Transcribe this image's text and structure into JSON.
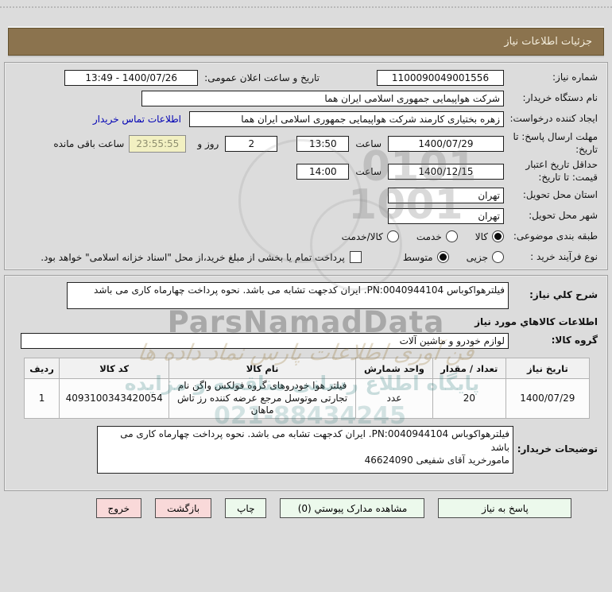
{
  "header": {
    "title": "جزئیات اطلاعات نیاز"
  },
  "form": {
    "need_number": {
      "label": "شماره نیاز:",
      "value": "1100090049001556"
    },
    "announce": {
      "label": "تاریخ و ساعت اعلان عمومی:",
      "value": "13:49 - 1400/07/26"
    },
    "buyer": {
      "label": "نام دستگاه خریدار:",
      "value": "شرکت هواپیمایی جمهوری اسلامی ایران هما"
    },
    "creator": {
      "label": "ایجاد کننده درخواست:",
      "value": "زهره بختیاری کارمند شرکت هواپیمایی جمهوری اسلامی ایران هما",
      "link": "اطلاعات تماس خریدار"
    },
    "deadline": {
      "label": "مهلت ارسال پاسخ: تا تاریخ:",
      "date": "1400/07/29",
      "hour_label": "ساعت",
      "time": "13:50",
      "days": "2",
      "days_label": "روز و",
      "countdown": "23:55:55",
      "remaining_label": "ساعت باقی مانده"
    },
    "validity": {
      "label": "حداقل تاریخ اعتبار قیمت: تا تاریخ:",
      "date": "1400/12/15",
      "hour_label": "ساعت",
      "time": "14:00"
    },
    "province": {
      "label": "استان محل تحویل:",
      "value": "تهران"
    },
    "city": {
      "label": "شهر محل تحویل:",
      "value": "تهران"
    },
    "classification": {
      "label": "طبقه بندی موضوعی:",
      "options": [
        {
          "label": "کالا",
          "selected": true
        },
        {
          "label": "خدمت",
          "selected": false
        },
        {
          "label": "کالا/خدمت",
          "selected": false
        }
      ]
    },
    "process": {
      "label": "نوع فرآیند خرید :",
      "options": [
        {
          "label": "جزیی",
          "selected": false
        },
        {
          "label": "متوسط",
          "selected": true
        }
      ],
      "checkbox_label": "پرداخت تمام یا بخشی از مبلغ خرید،از محل \"اسناد خزانه اسلامی\" خواهد بود.",
      "checkbox_checked": false
    }
  },
  "details": {
    "summary": {
      "label": "شرح کلي نیاز:",
      "value": "فیلترهواکوباس PN:0040944104. ایران کدجهت تشابه می باشد. نحوه پرداخت چهارماه کاری می باشد"
    },
    "goods_title": "اطلاعات کالاهاي مورد نیاز",
    "group": {
      "label": "گروه کالا:",
      "value": "لوازم خودرو و ماشین آلات"
    },
    "table": {
      "headers": [
        "ردیف",
        "کد کالا",
        "نام کالا",
        "واحد شمارش",
        "تعداد / مقدار",
        "تاریخ نیاز"
      ],
      "rows": [
        {
          "no": "1",
          "code": "4093100343420054",
          "name": "فیلتر هوا خودروهای گروه فولکس واگن نام تجارتی موتوسل مرجع عرضه کننده رز تاش ماهان",
          "unit": "عدد",
          "qty": "20",
          "date": "1400/07/29"
        }
      ]
    },
    "notes": {
      "label": "توضیحات خریدار:",
      "value": "فیلترهواکوباس PN:0040944104. ایران کدجهت تشابه می باشد. نحوه پرداخت چهارماه کاری می باشد\nمامورخرید آقای شفیعی 46624090"
    }
  },
  "buttons": {
    "reply": "پاسخ به نیاز",
    "attachments": "مشاهده مدارک پیوستي (0)",
    "print": "چاپ",
    "back": "بازگشت",
    "exit": "خروج"
  },
  "watermark": {
    "brand": "ParsNamadData",
    "line1": "فن آوری اطلاعات پارس نماد داده ها",
    "line2": "پایگاه اطلاع رسانی مناقصه و مزایده",
    "phone": "021-88434245",
    "digits1": "0101",
    "digits2": "1001"
  },
  "colors": {
    "page_bg": "#dcdcdc",
    "title_bar": "#8b734e",
    "title_text": "#f4eedd",
    "link": "#0000b4",
    "countdown_bg": "#f2f0c2",
    "button_green": "#ecf9ec",
    "button_pink": "#f9d9d9"
  }
}
